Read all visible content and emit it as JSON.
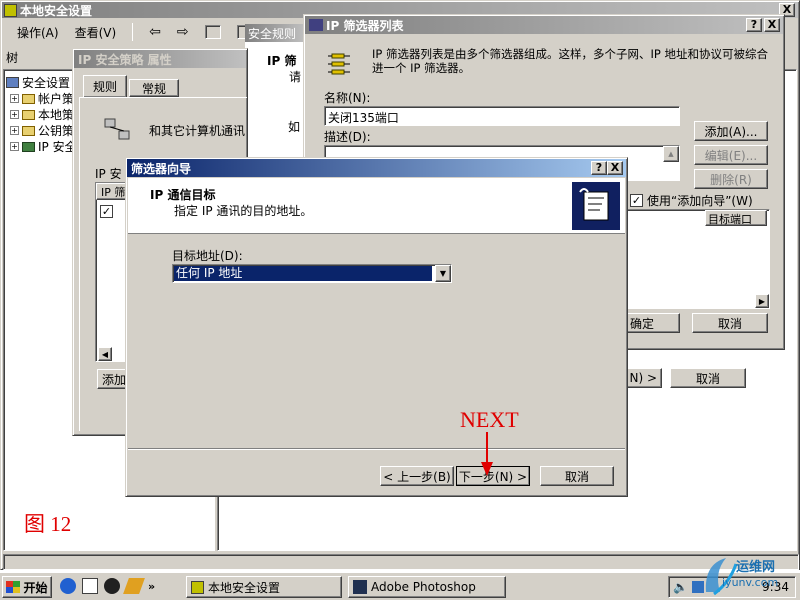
{
  "mmc": {
    "title": "本地安全设置",
    "menu": [
      "操作(A)",
      "查看(V)"
    ],
    "tree_header": "树",
    "tree_items": [
      "安全设置",
      "帐户策",
      "本地策",
      "公钥策",
      "IP 安全"
    ]
  },
  "bg_panel": {
    "header": "安全规则",
    "item_bold": "IP 筛",
    "item_sub": "请",
    "item2": "如"
  },
  "policy_props": {
    "title": "IP 安全策略 属性",
    "tabs": [
      "规则",
      "常规"
    ],
    "desc": "和其它计算机通讯",
    "list_label": "IP 安",
    "list_col": "IP 筛",
    "add_button": "添加"
  },
  "filter_list": {
    "title": "IP 筛选器列表",
    "help": "?",
    "close": "X",
    "description": "IP 筛选器列表是由多个筛选器组成。这样，多个子网、IP 地址和协议可被综合进一个 IP 筛选器。",
    "name_label": "名称(N):",
    "name_value": "关闭135端口",
    "desc_label": "描述(D):",
    "add_button": "添加(A)...",
    "edit_button": "编辑(E)...",
    "delete_button": "删除(R)",
    "use_wizard_label": "使用“添加向导”(W)",
    "col_dest_port": "目标端口",
    "ok_button": "确定",
    "cancel_button": "取消"
  },
  "behind_buttons": {
    "next_partial": "N) >",
    "cancel": "取消"
  },
  "wizard": {
    "title": "筛选器向导",
    "help": "?",
    "close": "X",
    "heading": "IP 通信目标",
    "subheading": "指定 IP 通讯的目的地址。",
    "dest_label": "目标地址(D):",
    "dest_value": "任何 IP 地址",
    "back_button": "< 上一步(B)",
    "next_button": "下一步(N) >",
    "cancel_button": "取消"
  },
  "annotations": {
    "next_label": "NEXT",
    "figure_label": "图 12"
  },
  "taskbar": {
    "start": "开始",
    "tasks": [
      "本地安全设置",
      "Adobe Photoshop"
    ],
    "clock": "9:34",
    "watermark_cn": "运维网",
    "watermark_url": "iyunv.com"
  },
  "colors": {
    "title_active": "#0a246a",
    "title_inactive": "#808080",
    "face": "#d4d0c8",
    "selection": "#0a246a",
    "annotation_red": "#e00000"
  }
}
